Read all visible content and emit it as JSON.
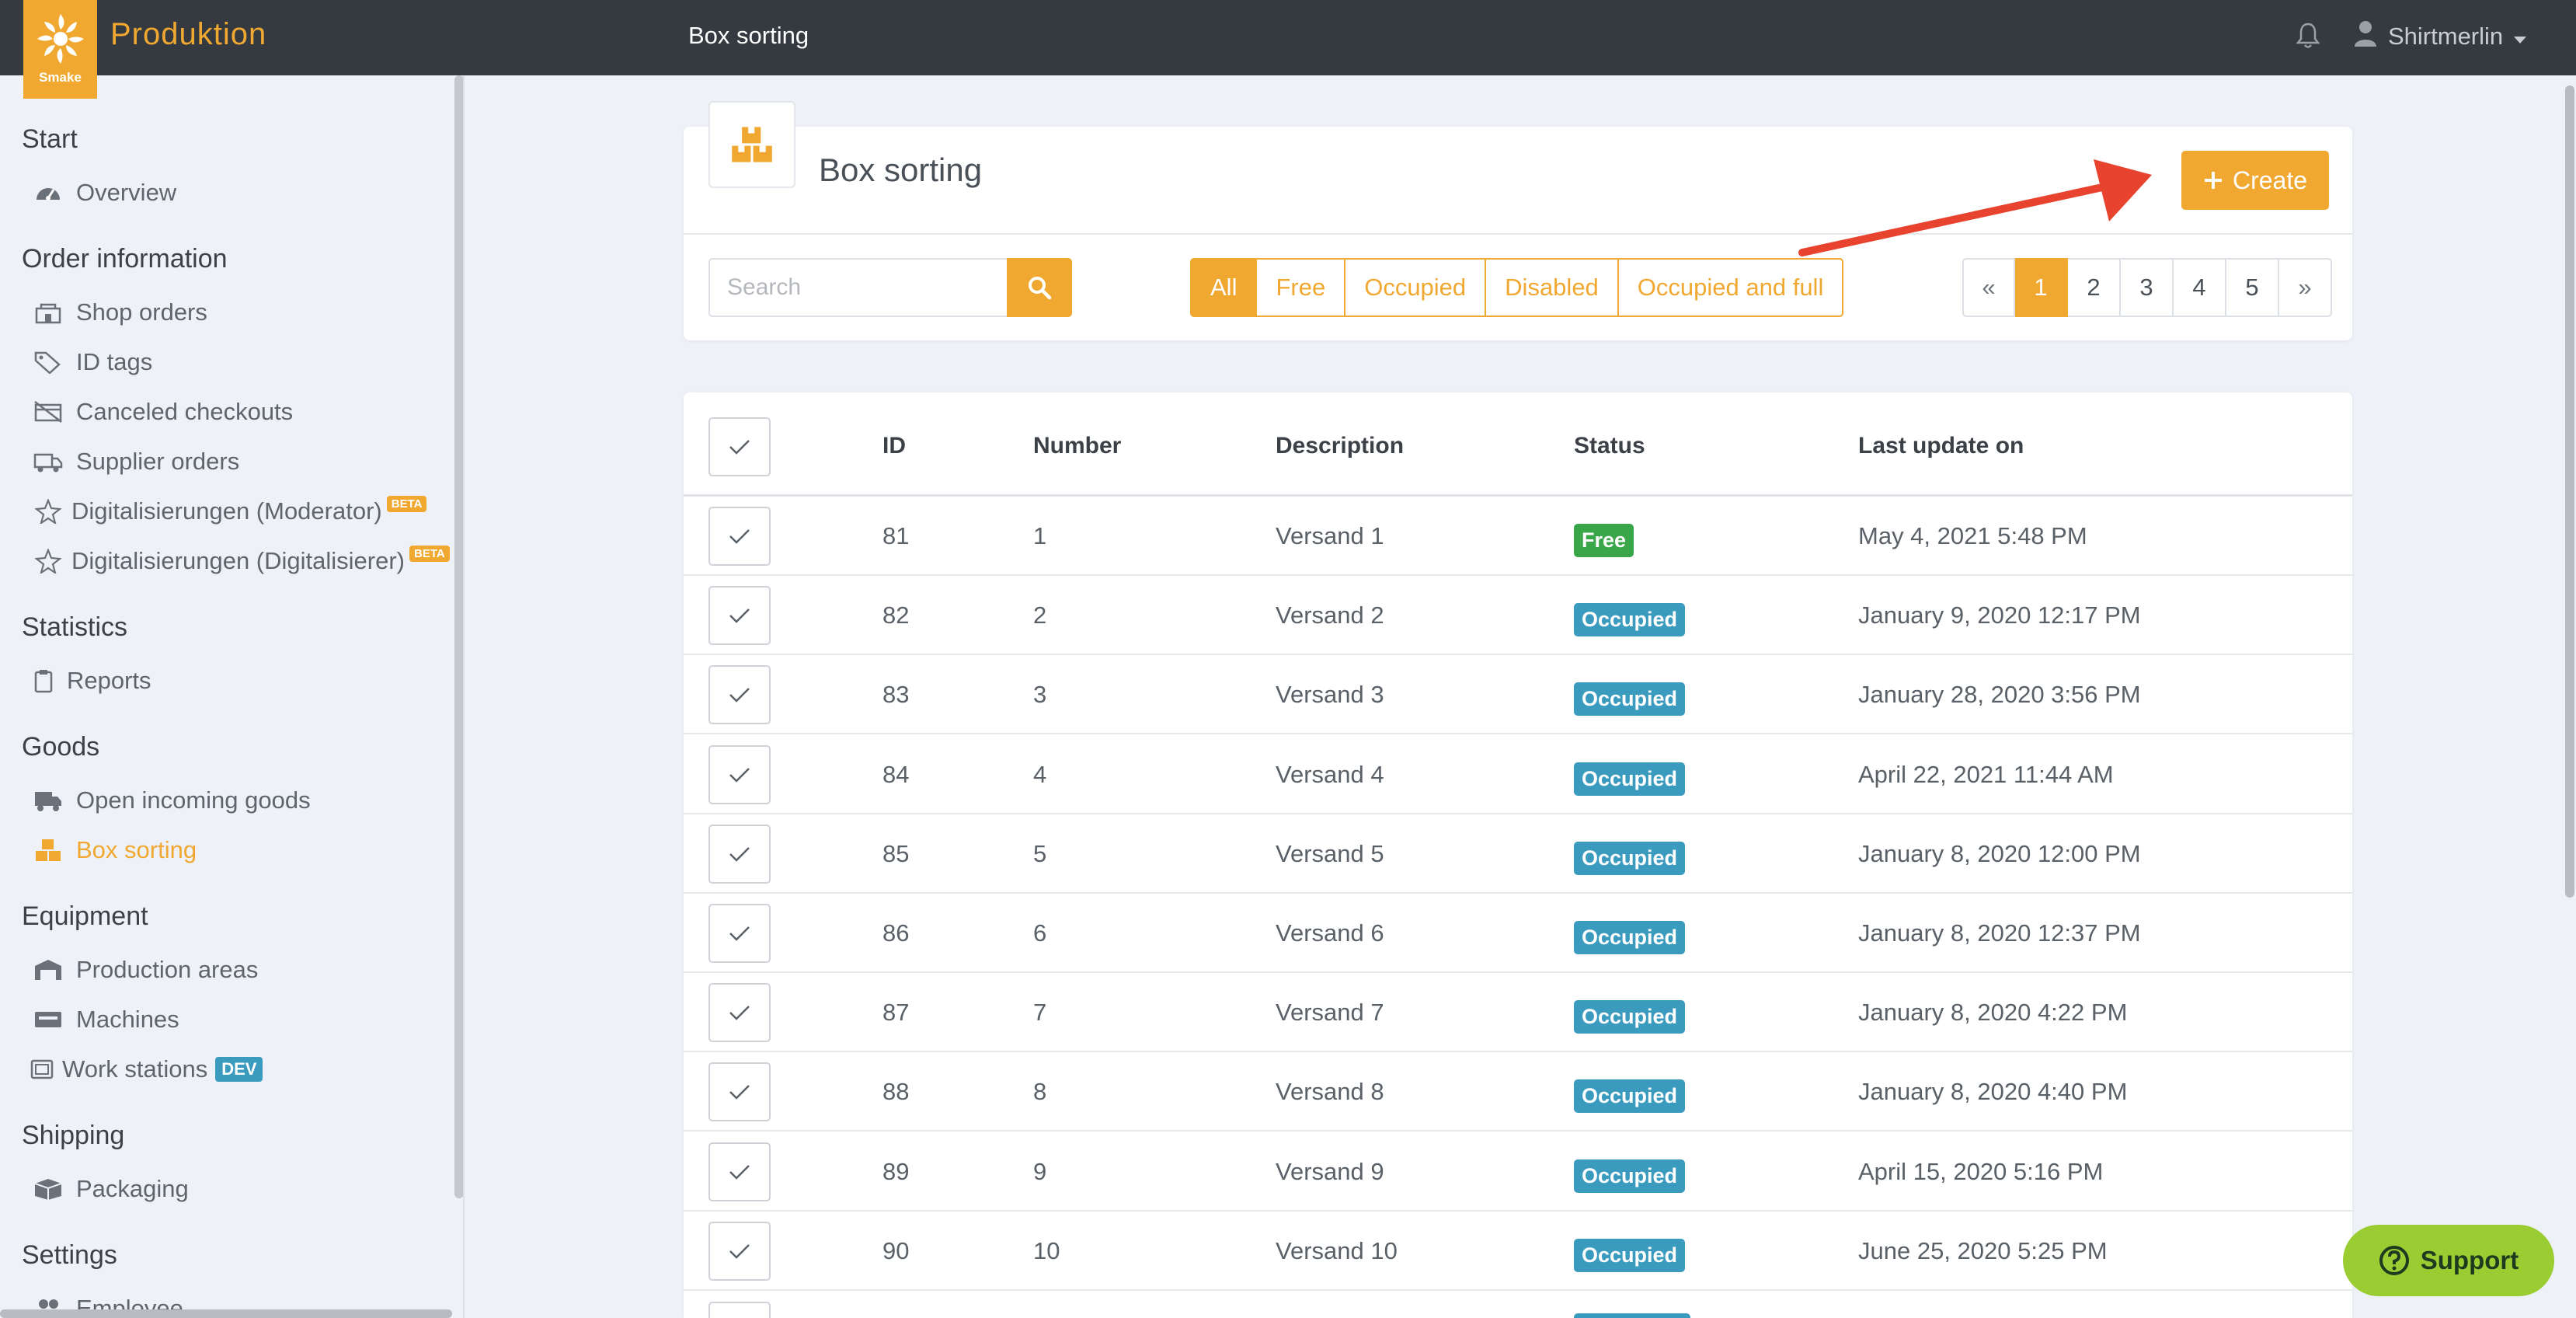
{
  "app": {
    "logo_text": "Smake",
    "brand": "Produktion",
    "page_title": "Box sorting",
    "user_name": "Shirtmerlin"
  },
  "colors": {
    "accent": "#f0a830",
    "topbar": "#343a40",
    "free": "#3aa64a",
    "occupied": "#3a9bbf",
    "support": "#9acd32"
  },
  "sidebar": {
    "sections": [
      {
        "title": "Start",
        "items": [
          {
            "label": "Overview",
            "icon": "dashboard-icon"
          }
        ]
      },
      {
        "title": "Order information",
        "items": [
          {
            "label": "Shop orders",
            "icon": "shop-icon"
          },
          {
            "label": "ID tags",
            "icon": "tags-icon"
          },
          {
            "label": "Canceled checkouts",
            "icon": "canceled-cart-icon"
          },
          {
            "label": "Supplier orders",
            "icon": "truck-icon"
          },
          {
            "label": "Digitalisierungen (Moderator)",
            "icon": "magic-icon",
            "badge": "BETA"
          },
          {
            "label": "Digitalisierungen (Digitalisierer)",
            "icon": "magic-icon",
            "badge": "BETA"
          }
        ]
      },
      {
        "title": "Statistics",
        "items": [
          {
            "label": "Reports",
            "icon": "clipboard-icon"
          }
        ]
      },
      {
        "title": "Goods",
        "items": [
          {
            "label": "Open incoming goods",
            "icon": "delivery-icon"
          },
          {
            "label": "Box sorting",
            "icon": "boxes-icon",
            "active": true
          }
        ]
      },
      {
        "title": "Equipment",
        "items": [
          {
            "label": "Production areas",
            "icon": "warehouse-icon"
          },
          {
            "label": "Machines",
            "icon": "machine-icon"
          },
          {
            "label": "Work stations",
            "icon": "workstation-icon",
            "badge": "DEV"
          }
        ]
      },
      {
        "title": "Shipping",
        "items": [
          {
            "label": "Packaging",
            "icon": "package-icon"
          }
        ]
      },
      {
        "title": "Settings",
        "items": [
          {
            "label": "Employee",
            "icon": "users-icon"
          }
        ]
      }
    ]
  },
  "header": {
    "title": "Box sorting",
    "create_label": "Create",
    "search_placeholder": "Search",
    "filters": [
      "All",
      "Free",
      "Occupied",
      "Disabled",
      "Occupied and full"
    ],
    "active_filter": "All",
    "pager": [
      "«",
      "1",
      "2",
      "3",
      "4",
      "5",
      "»"
    ],
    "active_page": "1"
  },
  "table": {
    "columns": [
      "ID",
      "Number",
      "Description",
      "Status",
      "Last update on"
    ],
    "rows": [
      {
        "id": "81",
        "number": "1",
        "description": "Versand 1",
        "status": "Free",
        "updated": "May 4, 2021 5:48 PM"
      },
      {
        "id": "82",
        "number": "2",
        "description": "Versand 2",
        "status": "Occupied",
        "updated": "January 9, 2020 12:17 PM"
      },
      {
        "id": "83",
        "number": "3",
        "description": "Versand 3",
        "status": "Occupied",
        "updated": "January 28, 2020 3:56 PM"
      },
      {
        "id": "84",
        "number": "4",
        "description": "Versand 4",
        "status": "Occupied",
        "updated": "April 22, 2021 11:44 AM"
      },
      {
        "id": "85",
        "number": "5",
        "description": "Versand 5",
        "status": "Occupied",
        "updated": "January 8, 2020 12:00 PM"
      },
      {
        "id": "86",
        "number": "6",
        "description": "Versand 6",
        "status": "Occupied",
        "updated": "January 8, 2020 12:37 PM"
      },
      {
        "id": "87",
        "number": "7",
        "description": "Versand 7",
        "status": "Occupied",
        "updated": "January 8, 2020 4:22 PM"
      },
      {
        "id": "88",
        "number": "8",
        "description": "Versand 8",
        "status": "Occupied",
        "updated": "January 8, 2020 4:40 PM"
      },
      {
        "id": "89",
        "number": "9",
        "description": "Versand 9",
        "status": "Occupied",
        "updated": "April 15, 2020 5:16 PM"
      },
      {
        "id": "90",
        "number": "10",
        "description": "Versand 10",
        "status": "Occupied",
        "updated": "June 25, 2020 5:25 PM"
      }
    ]
  },
  "support_label": "Support"
}
